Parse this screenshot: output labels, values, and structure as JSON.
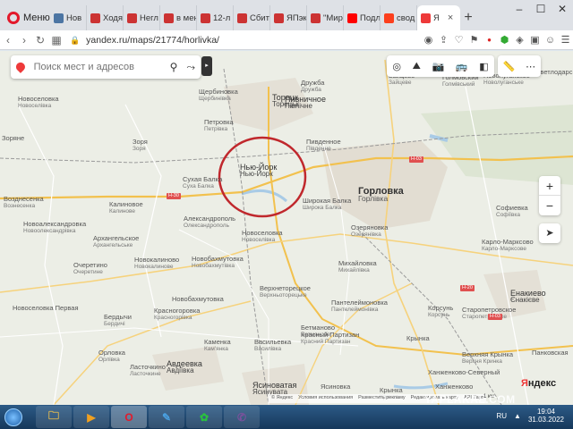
{
  "browser": {
    "menu_label": "Меню",
    "tabs": [
      {
        "label": "Нов",
        "color": "#4c75a3"
      },
      {
        "label": "Ходя",
        "color": "#cc3333"
      },
      {
        "label": "Негл",
        "color": "#cc3333"
      },
      {
        "label": "в мен",
        "color": "#cc3333"
      },
      {
        "label": "12-л",
        "color": "#cc3333"
      },
      {
        "label": "Сбит",
        "color": "#cc3333"
      },
      {
        "label": "ЯПэк",
        "color": "#cc3333"
      },
      {
        "label": "\"Мир",
        "color": "#cc3333"
      },
      {
        "label": "Подл",
        "color": "#ff0000"
      },
      {
        "label": "свод",
        "color": "#fc3f1d"
      },
      {
        "label": "Я",
        "color": "#ee3a3a"
      }
    ],
    "newtab_label": "+",
    "window_controls": [
      "–",
      "☐",
      "✕"
    ],
    "url": "yandex.ru/maps/21774/horlivka/"
  },
  "map": {
    "search_placeholder": "Поиск мест и адресов",
    "collapse_glyph": "▸",
    "zoom_in": "+",
    "zoom_out": "−",
    "footer_links": [
      "© Яндекс",
      "Условия использования",
      "Разместить рекламу",
      "Редактировать карту",
      "API Карт"
    ],
    "scale_label": "1 км",
    "logo": {
      "first": "Я",
      "rest": "ндекс"
    },
    "watermark": "YAPLAKAL.COM",
    "highlight_color": "#c0282d",
    "highway_shields": [
      "Н-30",
      "Н-03",
      "Н-20",
      "Н-03"
    ],
    "labels": [
      {
        "name": "Новоселовка",
        "sub": "Новоселівка",
        "cls": ""
      },
      {
        "name": "Зайцево",
        "sub": "Зайцеве",
        "cls": ""
      },
      {
        "name": "Голмовский",
        "sub": "Голмівський",
        "cls": ""
      },
      {
        "name": "Новолуганское",
        "sub": "Новолуганське",
        "cls": ""
      },
      {
        "name": "Светлодарск",
        "sub": "",
        "cls": ""
      },
      {
        "name": "Щербиновка",
        "sub": "Щербинівка",
        "cls": ""
      },
      {
        "name": "Дружба",
        "sub": "Дружба",
        "cls": ""
      },
      {
        "name": "Торецк",
        "sub": "Торецьк",
        "cls": "med"
      },
      {
        "name": "Пивничное",
        "sub": "Північне",
        "cls": "med"
      },
      {
        "name": "Петровка",
        "sub": "Петрівка",
        "cls": ""
      },
      {
        "name": "Зоряне",
        "sub": "",
        "cls": ""
      },
      {
        "name": "Зоря",
        "sub": "Зоря",
        "cls": ""
      },
      {
        "name": "Пивденное",
        "sub": "Південне",
        "cls": ""
      },
      {
        "name": "Нью-Йорк",
        "sub": "Нью-Йорк",
        "cls": "med"
      },
      {
        "name": "Сухая Балка",
        "sub": "Суха Балка",
        "cls": ""
      },
      {
        "name": "Горловка",
        "sub": "Горлівка",
        "cls": "big"
      },
      {
        "name": "Широкая Балка",
        "sub": "Широка Балка",
        "cls": ""
      },
      {
        "name": "Калиновое",
        "sub": "Калинове",
        "cls": ""
      },
      {
        "name": "Александрополь",
        "sub": "Олександрополь",
        "cls": ""
      },
      {
        "name": "Новоалександровка",
        "sub": "Новоолександрівка",
        "cls": ""
      },
      {
        "name": "Возднесенка",
        "sub": "Вознесенка",
        "cls": ""
      },
      {
        "name": "Озеряновка",
        "sub": "Озерянівка",
        "cls": ""
      },
      {
        "name": "Софиевка",
        "sub": "Софіївка",
        "cls": ""
      },
      {
        "name": "Карло-Марксово",
        "sub": "Карло-Марксове",
        "cls": ""
      },
      {
        "name": "Новоселовка",
        "sub": "Новоселівка",
        "cls": ""
      },
      {
        "name": "Архангельское",
        "sub": "Архангельське",
        "cls": ""
      },
      {
        "name": "Новокалиново",
        "sub": "Новокалинове",
        "cls": ""
      },
      {
        "name": "Новобахмутовка",
        "sub": "Новобахмутівка",
        "cls": ""
      },
      {
        "name": "Очеретино",
        "sub": "Очеретине",
        "cls": ""
      },
      {
        "name": "Михайловка",
        "sub": "Михайлівка",
        "cls": ""
      },
      {
        "name": "Енакиево",
        "sub": "Єнакієве",
        "cls": "med"
      },
      {
        "name": "Верхнеторецкое",
        "sub": "Верхньоторецьке",
        "cls": ""
      },
      {
        "name": "Пантелеймоновка",
        "sub": "Пантелеймонівка",
        "cls": ""
      },
      {
        "name": "Корсунь",
        "sub": "Корсунь",
        "cls": ""
      },
      {
        "name": "Старопетровское",
        "sub": "Старопетрівське",
        "cls": ""
      },
      {
        "name": "Новоселовка Первая",
        "sub": "",
        "cls": ""
      },
      {
        "name": "Бердычи",
        "sub": "Бердичі",
        "cls": ""
      },
      {
        "name": "Красногоровка",
        "sub": "Красногорівка",
        "cls": ""
      },
      {
        "name": "Новобахмутовка",
        "sub": "",
        "cls": ""
      },
      {
        "name": "Бетманово",
        "sub": "Бетманове",
        "cls": ""
      },
      {
        "name": "Красный Партизан",
        "sub": "Красний Партизан",
        "cls": ""
      },
      {
        "name": "Каменка",
        "sub": "Кам'янка",
        "cls": ""
      },
      {
        "name": "Васильевка",
        "sub": "Василівка",
        "cls": ""
      },
      {
        "name": "Верхняя Крынка",
        "sub": "Верхня Кринка",
        "cls": ""
      },
      {
        "name": "Орловка",
        "sub": "Орлівка",
        "cls": ""
      },
      {
        "name": "Ласточкино",
        "sub": "Ласточкине",
        "cls": ""
      },
      {
        "name": "Авдеевка",
        "sub": "Авдіївка",
        "cls": "med"
      },
      {
        "name": "Ясиноватая",
        "sub": "Ясинувата",
        "cls": "med"
      },
      {
        "name": "Ясиновка",
        "sub": "",
        "cls": ""
      },
      {
        "name": "Крынка",
        "sub": "",
        "cls": ""
      },
      {
        "name": "Крынка",
        "sub": "Кринка",
        "cls": ""
      },
      {
        "name": "Ханженково-Северный",
        "sub": "",
        "cls": ""
      },
      {
        "name": "Ханженково",
        "sub": "",
        "cls": ""
      },
      {
        "name": "Панковская",
        "sub": "",
        "cls": ""
      }
    ]
  },
  "taskbar": {
    "apps": [
      {
        "name": "explorer",
        "glyph": "🗀",
        "color": "#f1c24b"
      },
      {
        "name": "media",
        "glyph": "▶",
        "color": "#f0a020"
      },
      {
        "name": "opera",
        "glyph": "O",
        "color": "#e3192b"
      },
      {
        "name": "paint",
        "glyph": "✎",
        "color": "#4aa0e0"
      },
      {
        "name": "app-green",
        "glyph": "✿",
        "color": "#2ac23f"
      },
      {
        "name": "viber",
        "glyph": "✆",
        "color": "#7b519d"
      }
    ],
    "lang": "RU",
    "time": "19:04",
    "date": "31.03.2022"
  }
}
